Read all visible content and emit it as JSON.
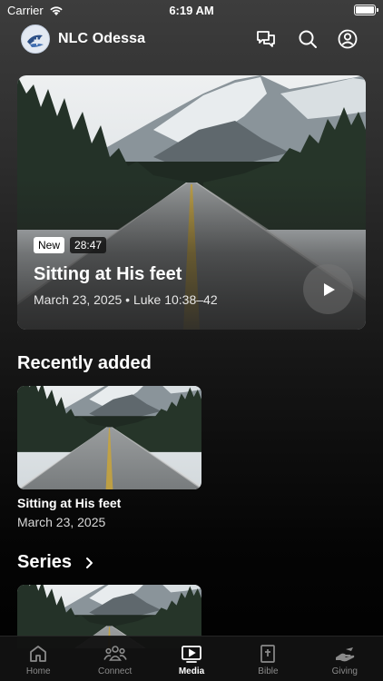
{
  "status_bar": {
    "carrier": "Carrier",
    "time": "6:19 AM"
  },
  "header": {
    "title": "NLC Odessa"
  },
  "featured": {
    "badge": "New",
    "duration": "28:47",
    "title": "Sitting at His feet",
    "meta": "March 23, 2025 • Luke 10:38–42"
  },
  "recently_added": {
    "heading": "Recently added",
    "items": [
      {
        "title": "Sitting at His feet",
        "date": "March 23, 2025"
      }
    ]
  },
  "series": {
    "heading": "Series"
  },
  "tabs": [
    {
      "label": "Home",
      "icon": "home-icon",
      "active": false
    },
    {
      "label": "Connect",
      "icon": "people-icon",
      "active": false
    },
    {
      "label": "Media",
      "icon": "play-screen-icon",
      "active": true
    },
    {
      "label": "Bible",
      "icon": "bible-icon",
      "active": false
    },
    {
      "label": "Giving",
      "icon": "giving-hand-icon",
      "active": false
    }
  ],
  "colors": {
    "background_top": "#3d3d3d",
    "background_bottom": "#000000",
    "tab_inactive": "#8a8a8a",
    "tab_active": "#ffffff"
  }
}
